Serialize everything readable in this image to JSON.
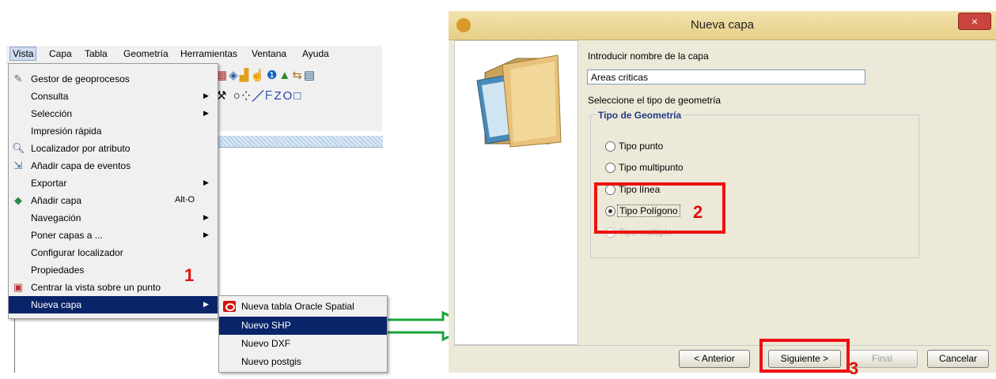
{
  "menubar": {
    "items": [
      "Vista",
      "Capa",
      "Tabla",
      "Geometría",
      "Herramientas",
      "Ventana",
      "Ayuda"
    ]
  },
  "vista_menu": {
    "items": [
      {
        "label": "Gestor de geoprocesos",
        "icon": "geoprocess-icon",
        "submenu": false,
        "shortcut": ""
      },
      {
        "label": "Consulta",
        "icon": "",
        "submenu": true,
        "shortcut": ""
      },
      {
        "label": "Selección",
        "icon": "",
        "submenu": true,
        "shortcut": ""
      },
      {
        "label": "Impresión rápida",
        "icon": "",
        "submenu": false,
        "shortcut": ""
      },
      {
        "label": "Localizador por atributo",
        "icon": "magnifier-icon",
        "submenu": false,
        "shortcut": ""
      },
      {
        "label": "Añadir capa de eventos",
        "icon": "add-events-icon",
        "submenu": false,
        "shortcut": ""
      },
      {
        "label": "Exportar",
        "icon": "",
        "submenu": true,
        "shortcut": ""
      },
      {
        "label": "Añadir capa",
        "icon": "add-layer-icon",
        "submenu": false,
        "shortcut": "Alt-O"
      },
      {
        "label": "Navegación",
        "icon": "",
        "submenu": true,
        "shortcut": ""
      },
      {
        "label": "Poner capas a ...",
        "icon": "",
        "submenu": true,
        "shortcut": ""
      },
      {
        "label": "Configurar localizador",
        "icon": "",
        "submenu": false,
        "shortcut": ""
      },
      {
        "label": "Propiedades",
        "icon": "",
        "submenu": false,
        "shortcut": ""
      },
      {
        "label": "Centrar la vista sobre un punto",
        "icon": "center-view-icon",
        "submenu": false,
        "shortcut": ""
      },
      {
        "label": "Nueva capa",
        "icon": "",
        "submenu": true,
        "shortcut": ""
      }
    ]
  },
  "nueva_capa_submenu": {
    "items": [
      "Nueva tabla Oracle Spatial",
      "Nuevo SHP",
      "Nuevo DXF",
      "Nuevo postgis"
    ]
  },
  "dialog": {
    "title": "Nueva capa",
    "close": "×",
    "name_label": "Introducir nombre de la capa",
    "name_value": "Areas criticas",
    "geom_prompt": "Seleccione el tipo de geometría",
    "group_title": "Tipo de Geometría",
    "options": [
      "Tipo punto",
      "Tipo multipunto",
      "Tipo línea",
      "Tipo Polígono",
      "Tipo múltiple"
    ],
    "buttons": {
      "prev": "< Anterior",
      "next": "Siguiente >",
      "finish": "Final",
      "cancel": "Cancelar"
    }
  },
  "annotations": {
    "step1": "1",
    "step2": "2",
    "step3": "3"
  },
  "colors": {
    "highlight": "#0a246a",
    "annotation_red": "#ee1111",
    "arrow_green": "#1aa33a",
    "map_yellow": "#ffffd4"
  }
}
